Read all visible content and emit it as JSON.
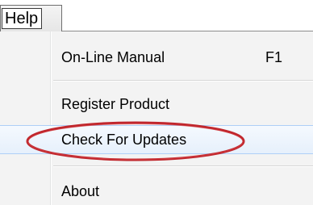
{
  "menubar": {
    "help_label": "Help"
  },
  "menu": {
    "items": [
      {
        "label": "On-Line Manual",
        "shortcut": "F1"
      },
      {
        "label": "Register Product"
      },
      {
        "label": "Check For Updates",
        "highlighted": true
      },
      {
        "label": "About"
      }
    ]
  },
  "annotation": {
    "color": "#c0262c",
    "target": "Check For Updates"
  }
}
